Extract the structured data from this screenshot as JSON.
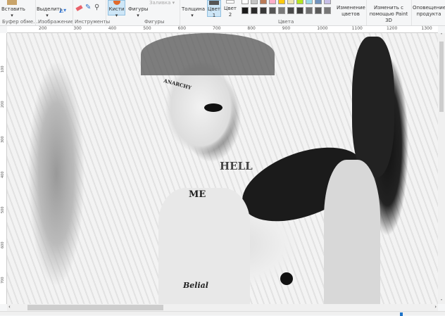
{
  "ribbon": {
    "paste": "Вставить",
    "select": "Выделить",
    "brushes": "Кисти",
    "shapes": "Фигуры",
    "fill": "Заливка",
    "thickness": "Толщина",
    "color1": "Цвет",
    "color1_num": "1",
    "color2": "Цвет",
    "color2_num": "2",
    "edit_colors_1": "Изменение",
    "edit_colors_2": "цветов",
    "paint3d_1": "Изменить с",
    "paint3d_2": "помощью Paint 3D",
    "notify_1": "Оповещение",
    "notify_2": "продукта",
    "groups": {
      "clipboard": "Буфер обме...",
      "image": "Изображение",
      "tools": "Инструменты",
      "shapes": "Фигуры",
      "colors": "Цвета"
    }
  },
  "palette": {
    "row1": [
      "#ffffff",
      "#c3c3c3",
      "#b97a57",
      "#ffaec9",
      "#ffc90e",
      "#efe4b0",
      "#b5e61d",
      "#99d9ea",
      "#7092be",
      "#c8bfe7"
    ],
    "row2": [
      "#1a1a1a",
      "#2a2a2a",
      "#383838",
      "#555555",
      "#7a7a7a",
      "#4a4a4a",
      "#3c3c3c",
      "#6f6f6f",
      "#5a5a5a",
      "#777777"
    ],
    "color1": "#555555",
    "color2": "#ffffff"
  },
  "ruler_top": [
    "200",
    "300",
    "400",
    "500",
    "600",
    "700",
    "800",
    "900",
    "1000",
    "1100",
    "1200",
    "1300"
  ],
  "ruler_left": [
    "100",
    "200",
    "300",
    "400",
    "500",
    "600",
    "700"
  ],
  "artwork": {
    "text1": "HELL",
    "text2": "ME",
    "text3": "Belial",
    "text4": "ANARCHY"
  }
}
